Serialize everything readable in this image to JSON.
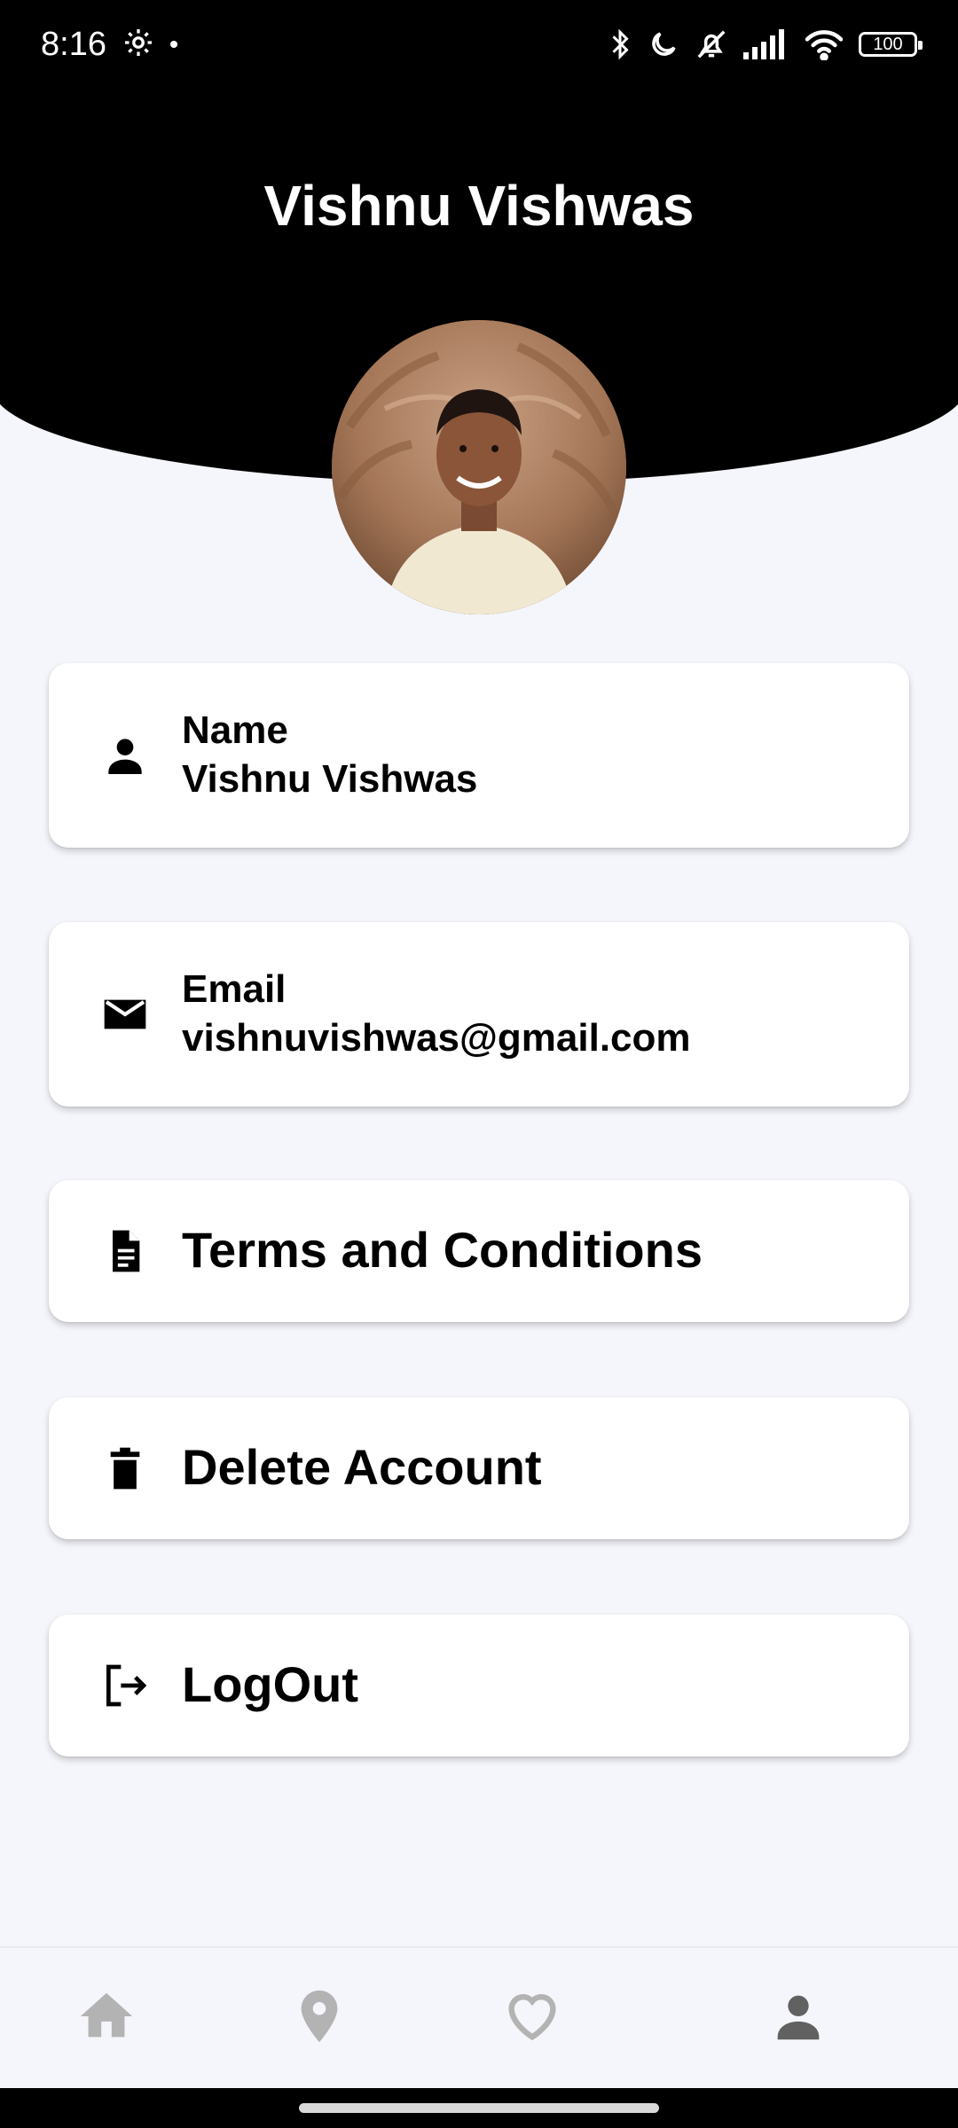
{
  "status_bar": {
    "time": "8:16",
    "battery": "100"
  },
  "profile": {
    "title": "Vishnu Vishwas"
  },
  "cards": {
    "name": {
      "label": "Name",
      "value": "Vishnu Vishwas"
    },
    "email": {
      "label": "Email",
      "value": "vishnuvishwas@gmail.com"
    },
    "terms": {
      "label": "Terms and Conditions"
    },
    "delete": {
      "label": "Delete Account"
    },
    "logout": {
      "label": "LogOut"
    }
  },
  "bottom_nav": {
    "items": [
      {
        "icon": "home-icon",
        "active": false
      },
      {
        "icon": "location-pin-icon",
        "active": false
      },
      {
        "icon": "heart-icon",
        "active": false
      },
      {
        "icon": "person-icon",
        "active": true
      }
    ],
    "active_color": "#616161",
    "inactive_color": "#b3b3b3"
  }
}
